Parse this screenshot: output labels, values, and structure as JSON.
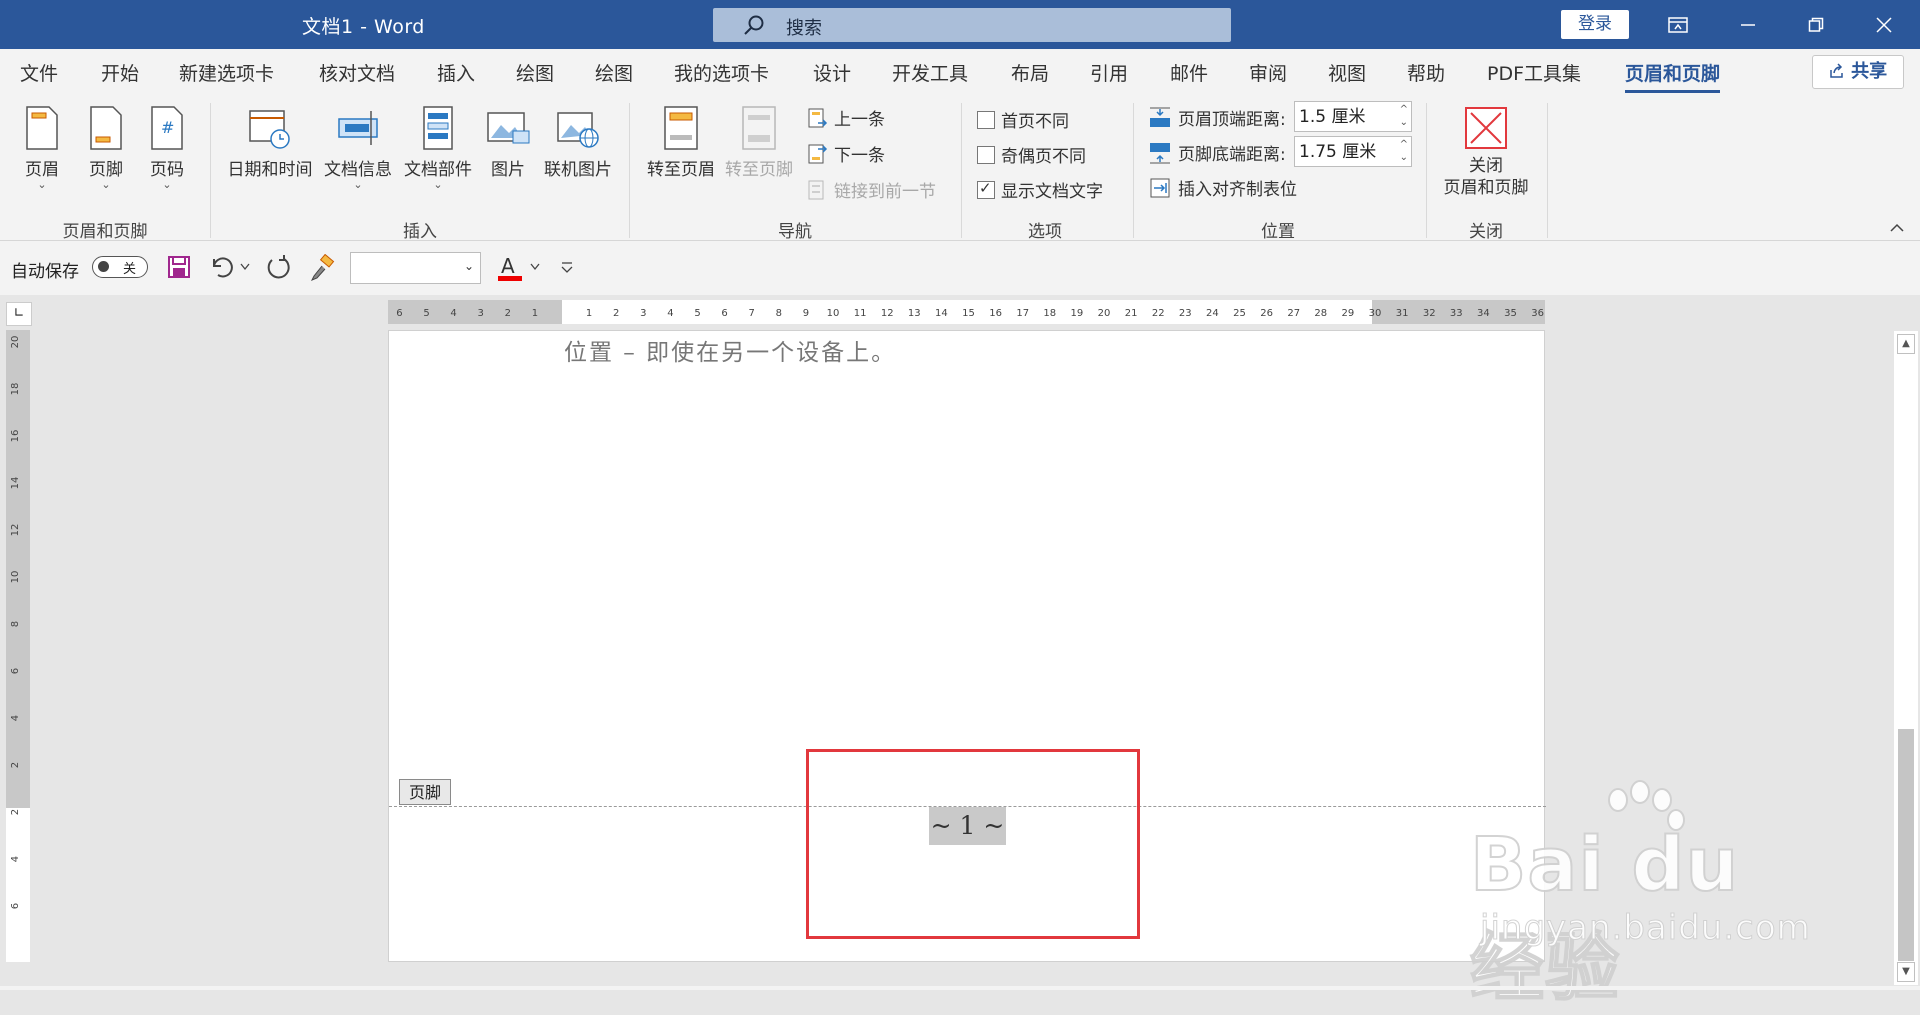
{
  "titlebar": {
    "title": "文档1  -  Word",
    "search_placeholder": "搜索",
    "login": "登录"
  },
  "tabs": [
    "文件",
    "开始",
    "新建选项卡",
    "核对文档",
    "插入",
    "绘图",
    "绘图",
    "我的选项卡",
    "设计",
    "开发工具",
    "布局",
    "引用",
    "邮件",
    "审阅",
    "视图",
    "帮助",
    "PDF工具集",
    "页眉和页脚"
  ],
  "active_tab": "页眉和页脚",
  "share_label": "共享",
  "ribbon": {
    "groups": {
      "header_footer": {
        "label": "页眉和页脚",
        "header": "页眉",
        "footer": "页脚",
        "page_number": "页码"
      },
      "insert": {
        "label": "插入",
        "datetime": "日期和时间",
        "docinfo": "文档信息",
        "quickparts": "文档部件",
        "picture": "图片",
        "online_picture": "联机图片"
      },
      "navigation": {
        "label": "导航",
        "goto_header": "转至页眉",
        "goto_footer": "转至页脚",
        "previous": "上一条",
        "next": "下一条",
        "link_previous": "链接到前一节"
      },
      "options": {
        "label": "选项",
        "different_first": "首页不同",
        "different_odd_even": "奇偶页不同",
        "show_doc_text": "显示文档文字"
      },
      "position": {
        "label": "位置",
        "header_from_top_label": "页眉顶端距离:",
        "header_from_top_value": "1.5 厘米",
        "footer_from_bottom_label": "页脚底端距离:",
        "footer_from_bottom_value": "1.75 厘米",
        "insert_alignment_tab": "插入对齐制表位"
      },
      "close": {
        "label": "关闭",
        "close_line1": "关闭",
        "close_line2": "页眉和页脚"
      }
    }
  },
  "qat": {
    "autosave": "自动保存",
    "toggle": "关"
  },
  "document": {
    "body_text": "位置 – 即使在另一个设备上。",
    "footer_tag": "页脚",
    "page_number": "~ 1 ~"
  },
  "watermark": {
    "main": "Bai du 经验",
    "sub": "jingyan.baidu.com"
  },
  "ruler": {
    "h_left": [
      "6",
      "5",
      "4",
      "3",
      "2",
      "1"
    ],
    "h_right": [
      "1",
      "2",
      "3",
      "4",
      "5",
      "6",
      "7",
      "8",
      "9",
      "10",
      "11",
      "12",
      "13",
      "14",
      "15",
      "16",
      "17",
      "18",
      "19",
      "20",
      "21",
      "22",
      "23",
      "24",
      "25",
      "26",
      "27",
      "28",
      "29",
      "30",
      "31",
      "32",
      "33",
      "34",
      "35",
      "36"
    ],
    "v": [
      "20",
      "18",
      "16",
      "14",
      "12",
      "10",
      "8",
      "6",
      "4",
      "2",
      "2",
      "4",
      "6"
    ]
  },
  "colors": {
    "brand": "#2b579a",
    "highlight_box": "#e2383d"
  }
}
